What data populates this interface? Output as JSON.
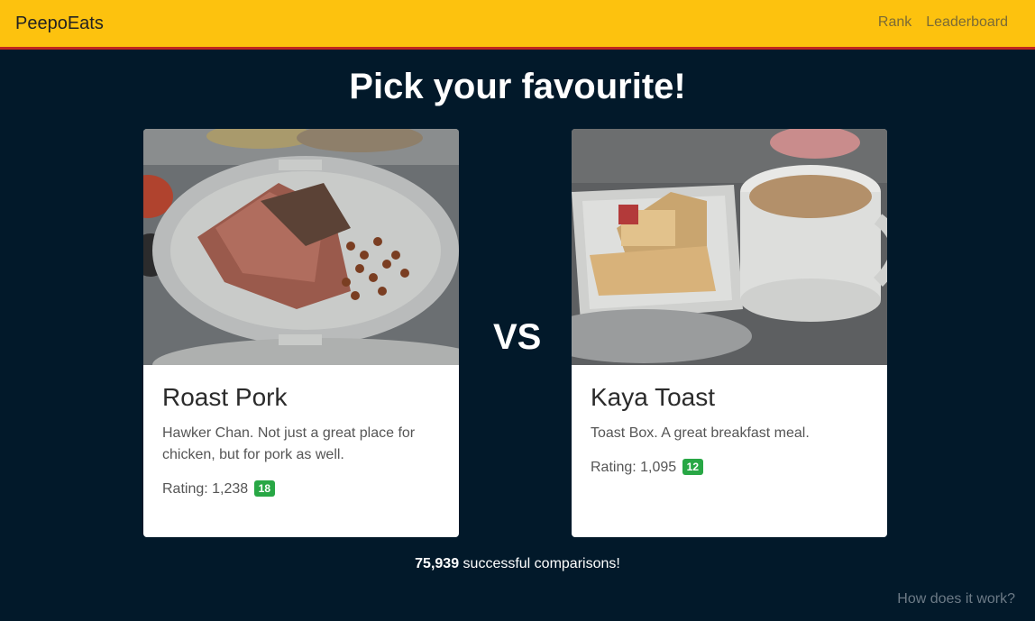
{
  "navbar": {
    "brand": "PeepoEats",
    "links": [
      "Rank",
      "Leaderboard"
    ]
  },
  "page_title": "Pick your favourite!",
  "cards": [
    {
      "title": "Roast Pork",
      "description": "Hawker Chan. Not just a great place for chicken, but for pork as well.",
      "rating_label": "Rating:",
      "rating_value": "1,238",
      "badge": "18"
    },
    {
      "title": "Kaya Toast",
      "description": "Toast Box. A great breakfast meal.",
      "rating_label": "Rating:",
      "rating_value": "1,095",
      "badge": "12"
    }
  ],
  "vs_label": "VS",
  "comparisons": {
    "count": "75,939",
    "suffix": " successful comparisons!"
  },
  "footer_link": "How does it work?",
  "colors": {
    "navbar": "#fdc20e",
    "navbar_border": "#c0271f",
    "background": "#02192a",
    "badge": "#28a745"
  }
}
